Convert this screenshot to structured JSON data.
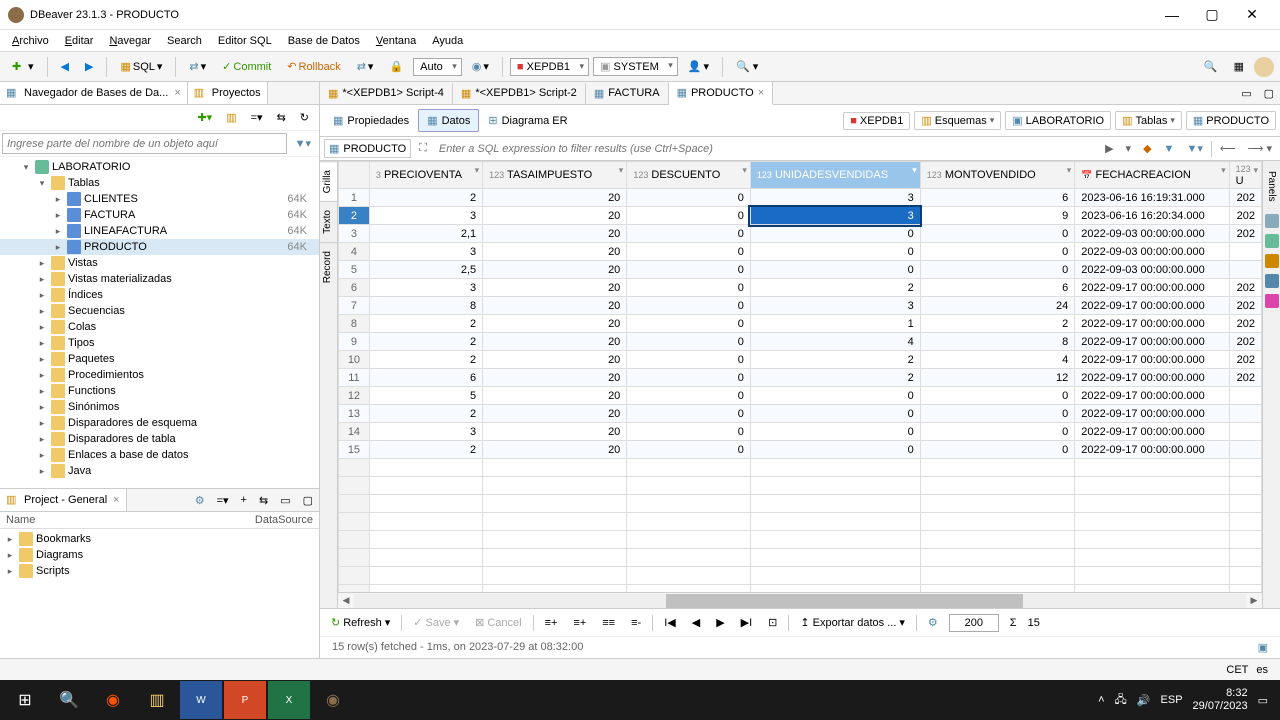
{
  "window": {
    "title": "DBeaver 23.1.3 - PRODUCTO"
  },
  "menu": {
    "archivo": "Archivo",
    "editar": "Editar",
    "navegar": "Navegar",
    "search": "Search",
    "editor_sql": "Editor SQL",
    "base_de_datos": "Base de Datos",
    "ventana": "Ventana",
    "ayuda": "Ayuda"
  },
  "toolbar": {
    "sql": "SQL",
    "commit": "Commit",
    "rollback": "Rollback",
    "auto": "Auto",
    "conn": "XEPDB1",
    "schema": "SYSTEM"
  },
  "nav": {
    "panel_title": "Navegador de Bases de Da...",
    "projects_tab": "Proyectos",
    "search_ph": "Ingrese parte del nombre de un objeto aquí",
    "db": "LABORATORIO",
    "tablas": "Tablas",
    "tables": [
      {
        "name": "CLIENTES",
        "size": "64K"
      },
      {
        "name": "FACTURA",
        "size": "64K"
      },
      {
        "name": "LINEAFACTURA",
        "size": "64K"
      },
      {
        "name": "PRODUCTO",
        "size": "64K",
        "selected": true
      }
    ],
    "folders": [
      "Vistas",
      "Vistas materializadas",
      "Índices",
      "Secuencias",
      "Colas",
      "Tipos",
      "Paquetes",
      "Procedimientos",
      "Functions",
      "Sinónimos",
      "Disparadores de esquema",
      "Disparadores de tabla",
      "Enlaces a base de datos",
      "Java"
    ]
  },
  "project": {
    "panel": "Project - General",
    "col_name": "Name",
    "col_ds": "DataSource",
    "items": [
      "Bookmarks",
      "Diagrams",
      "Scripts"
    ]
  },
  "editor_tabs": {
    "t1": "*<XEPDB1> Script-4",
    "t2": "*<XEPDB1> Script-2",
    "t3": "FACTURA",
    "t4": "PRODUCTO"
  },
  "subtabs": {
    "props": "Propiedades",
    "data": "Datos",
    "er": "Diagrama ER"
  },
  "breadcrumb": {
    "conn": "XEPDB1",
    "schemas": "Esquemas",
    "schema": "LABORATORIO",
    "tablas": "Tablas",
    "table": "PRODUCTO"
  },
  "filter": {
    "table": "PRODUCTO",
    "ph": "Enter a SQL expression to filter results (use Ctrl+Space)"
  },
  "side_tabs": {
    "grilla": "Grilla",
    "texto": "Texto",
    "record": "Record",
    "panels": "Panels"
  },
  "columns": {
    "precio": "PRECIOVENTA",
    "tasa": "TASAIMPUESTO",
    "desc": "DESCUENTO",
    "unid": "UNIDADESVENDIDAS",
    "monto": "MONTOVENDIDO",
    "fecha": "FECHACREACION",
    "u": "U"
  },
  "rows": [
    {
      "precio": "2",
      "tasa": "20",
      "desc": "0",
      "unid": "3",
      "monto": "6",
      "fecha": "2023-06-16 16:19:31.000",
      "u": "202"
    },
    {
      "precio": "3",
      "tasa": "20",
      "desc": "0",
      "unid": "3",
      "monto": "9",
      "fecha": "2023-06-16 16:20:34.000",
      "u": "202"
    },
    {
      "precio": "2,1",
      "tasa": "20",
      "desc": "0",
      "unid": "0",
      "monto": "0",
      "fecha": "2022-09-03 00:00:00.000",
      "u": "202"
    },
    {
      "precio": "3",
      "tasa": "20",
      "desc": "0",
      "unid": "0",
      "monto": "0",
      "fecha": "2022-09-03 00:00:00.000",
      "u": ""
    },
    {
      "precio": "2,5",
      "tasa": "20",
      "desc": "0",
      "unid": "0",
      "monto": "0",
      "fecha": "2022-09-03 00:00:00.000",
      "u": ""
    },
    {
      "precio": "3",
      "tasa": "20",
      "desc": "0",
      "unid": "2",
      "monto": "6",
      "fecha": "2022-09-17 00:00:00.000",
      "u": "202"
    },
    {
      "precio": "8",
      "tasa": "20",
      "desc": "0",
      "unid": "3",
      "monto": "24",
      "fecha": "2022-09-17 00:00:00.000",
      "u": "202"
    },
    {
      "precio": "2",
      "tasa": "20",
      "desc": "0",
      "unid": "1",
      "monto": "2",
      "fecha": "2022-09-17 00:00:00.000",
      "u": "202"
    },
    {
      "precio": "2",
      "tasa": "20",
      "desc": "0",
      "unid": "4",
      "monto": "8",
      "fecha": "2022-09-17 00:00:00.000",
      "u": "202"
    },
    {
      "precio": "2",
      "tasa": "20",
      "desc": "0",
      "unid": "2",
      "monto": "4",
      "fecha": "2022-09-17 00:00:00.000",
      "u": "202"
    },
    {
      "precio": "6",
      "tasa": "20",
      "desc": "0",
      "unid": "2",
      "monto": "12",
      "fecha": "2022-09-17 00:00:00.000",
      "u": "202"
    },
    {
      "precio": "5",
      "tasa": "20",
      "desc": "0",
      "unid": "0",
      "monto": "0",
      "fecha": "2022-09-17 00:00:00.000",
      "u": ""
    },
    {
      "precio": "2",
      "tasa": "20",
      "desc": "0",
      "unid": "0",
      "monto": "0",
      "fecha": "2022-09-17 00:00:00.000",
      "u": ""
    },
    {
      "precio": "3",
      "tasa": "20",
      "desc": "0",
      "unid": "0",
      "monto": "0",
      "fecha": "2022-09-17 00:00:00.000",
      "u": ""
    },
    {
      "precio": "2",
      "tasa": "20",
      "desc": "0",
      "unid": "0",
      "monto": "0",
      "fecha": "2022-09-17 00:00:00.000",
      "u": ""
    }
  ],
  "selected_row_idx": 1,
  "bottom": {
    "refresh": "Refresh",
    "save": "Save",
    "cancel": "Cancel",
    "export": "Exportar datos ...",
    "limit": "200",
    "rows": "15"
  },
  "status": {
    "msg": "15 row(s) fetched - 1ms, on 2023-07-29 at 08:32:00",
    "tz": "CET",
    "lang": "es"
  },
  "tray": {
    "time": "8:32",
    "date": "29/07/2023",
    "lang": "ESP"
  }
}
